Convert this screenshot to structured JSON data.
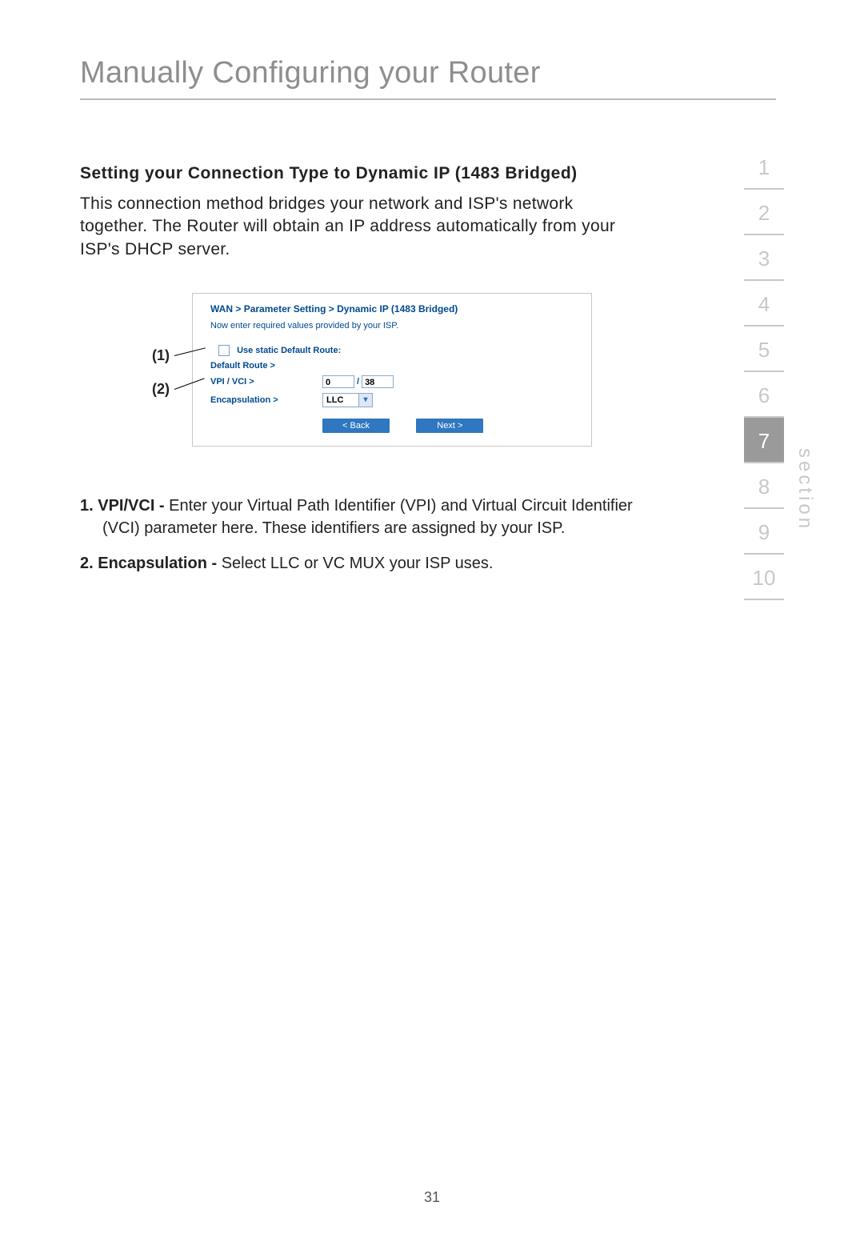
{
  "header": {
    "title": "Manually Configuring your Router"
  },
  "section": {
    "heading": "Setting your Connection Type to Dynamic IP (1483 Bridged)",
    "paragraph": "This connection method bridges your network and ISP's network together. The Router will obtain an IP address automatically from your ISP's DHCP server."
  },
  "callouts": {
    "one": "(1)",
    "two": "(2)"
  },
  "panel": {
    "breadcrumb": {
      "a": "WAN",
      "b": "Parameter Setting",
      "c": "Dynamic IP (1483 Bridged)",
      "sep": ">"
    },
    "subnote": "Now enter required values provided by your ISP.",
    "rows": {
      "static_label": "Use static Default Route:",
      "default_route_label": "Default Route >",
      "vpi_vci_label": "VPI / VCI >",
      "vpi_value": "0",
      "vci_value": "38",
      "slash": "/",
      "encaps_label": "Encapsulation >",
      "encaps_value": "LLC"
    },
    "buttons": {
      "back": "< Back",
      "next": "Next >"
    }
  },
  "definitions": {
    "item1_label": "1. VPI/VCI - ",
    "item1_text": "Enter your Virtual Path Identifier (VPI) and Virtual Circuit Identifier (VCI) parameter here. These identifiers are assigned by your ISP.",
    "item2_label": "2. Encapsulation - ",
    "item2_text": "Select LLC or VC MUX your ISP uses."
  },
  "tabs": {
    "items": [
      "1",
      "2",
      "3",
      "4",
      "5",
      "6",
      "7",
      "8",
      "9",
      "10"
    ],
    "active_index": 6,
    "side_label": "section"
  },
  "page_number": "31"
}
